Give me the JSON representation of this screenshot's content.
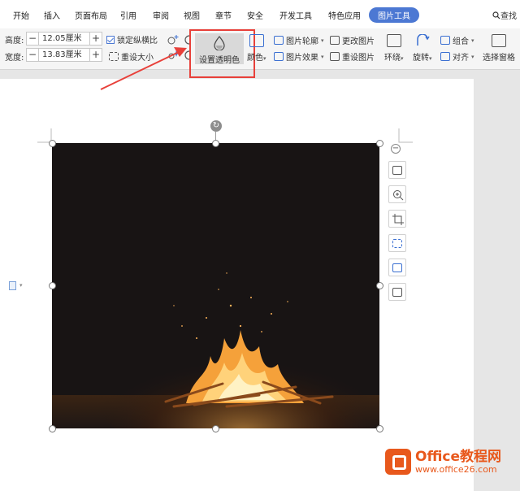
{
  "menu": {
    "tabs": [
      "开始",
      "插入",
      "页面布局",
      "引用",
      "审阅",
      "视图",
      "章节",
      "安全",
      "开发工具",
      "特色应用",
      "图片工具"
    ],
    "active_tab": "图片工具",
    "search_label": "查找"
  },
  "ribbon": {
    "height_label": "高度:",
    "height_value": "12.05厘米",
    "width_label": "宽度:",
    "width_value": "13.83厘米",
    "lock_ratio_label": "锁定纵横比",
    "reset_size_label": "重设大小",
    "set_transparent_label": "设置透明色",
    "color_label": "颜色",
    "outline_label": "图片轮廓",
    "effects_label": "图片效果",
    "change_image_label": "更改图片",
    "reset_image_label": "重设图片",
    "wrap_label": "环绕",
    "rotate_label": "旋转",
    "group_label": "组合",
    "align_label": "对齐",
    "selection_pane_label": "选择窗格"
  },
  "watermark": {
    "title": "Office教程网",
    "url": "www.office26.com"
  },
  "colors": {
    "accent": "#4c78d3",
    "highlight": "#e8403a",
    "brand": "#e8581c"
  }
}
